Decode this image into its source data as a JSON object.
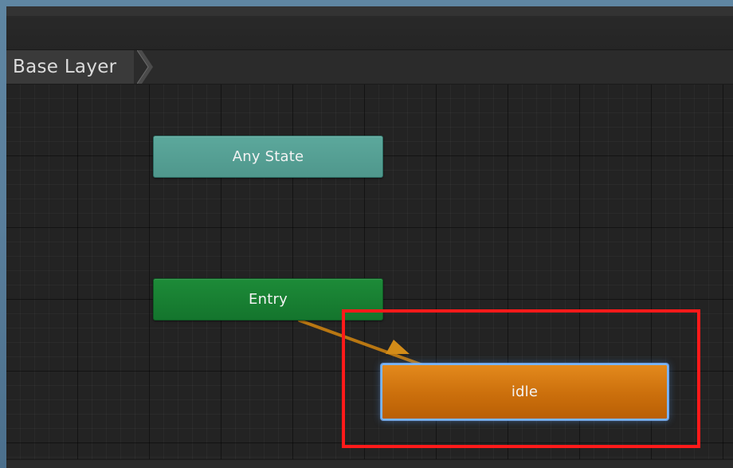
{
  "breadcrumb": {
    "items": [
      {
        "label": "Base Layer"
      }
    ]
  },
  "states": {
    "any_state": {
      "label": "Any State"
    },
    "entry": {
      "label": "Entry"
    },
    "idle": {
      "label": "idle"
    }
  },
  "transition": {
    "from": "Entry",
    "to": "idle"
  },
  "highlight": {
    "target": "idle",
    "color": "#ff1a1a"
  },
  "colors": {
    "any_state": "#5ca89c",
    "entry": "#1d8b38",
    "idle": "#d97712",
    "selection": "#7ab6ff",
    "transition": "#c78519"
  }
}
